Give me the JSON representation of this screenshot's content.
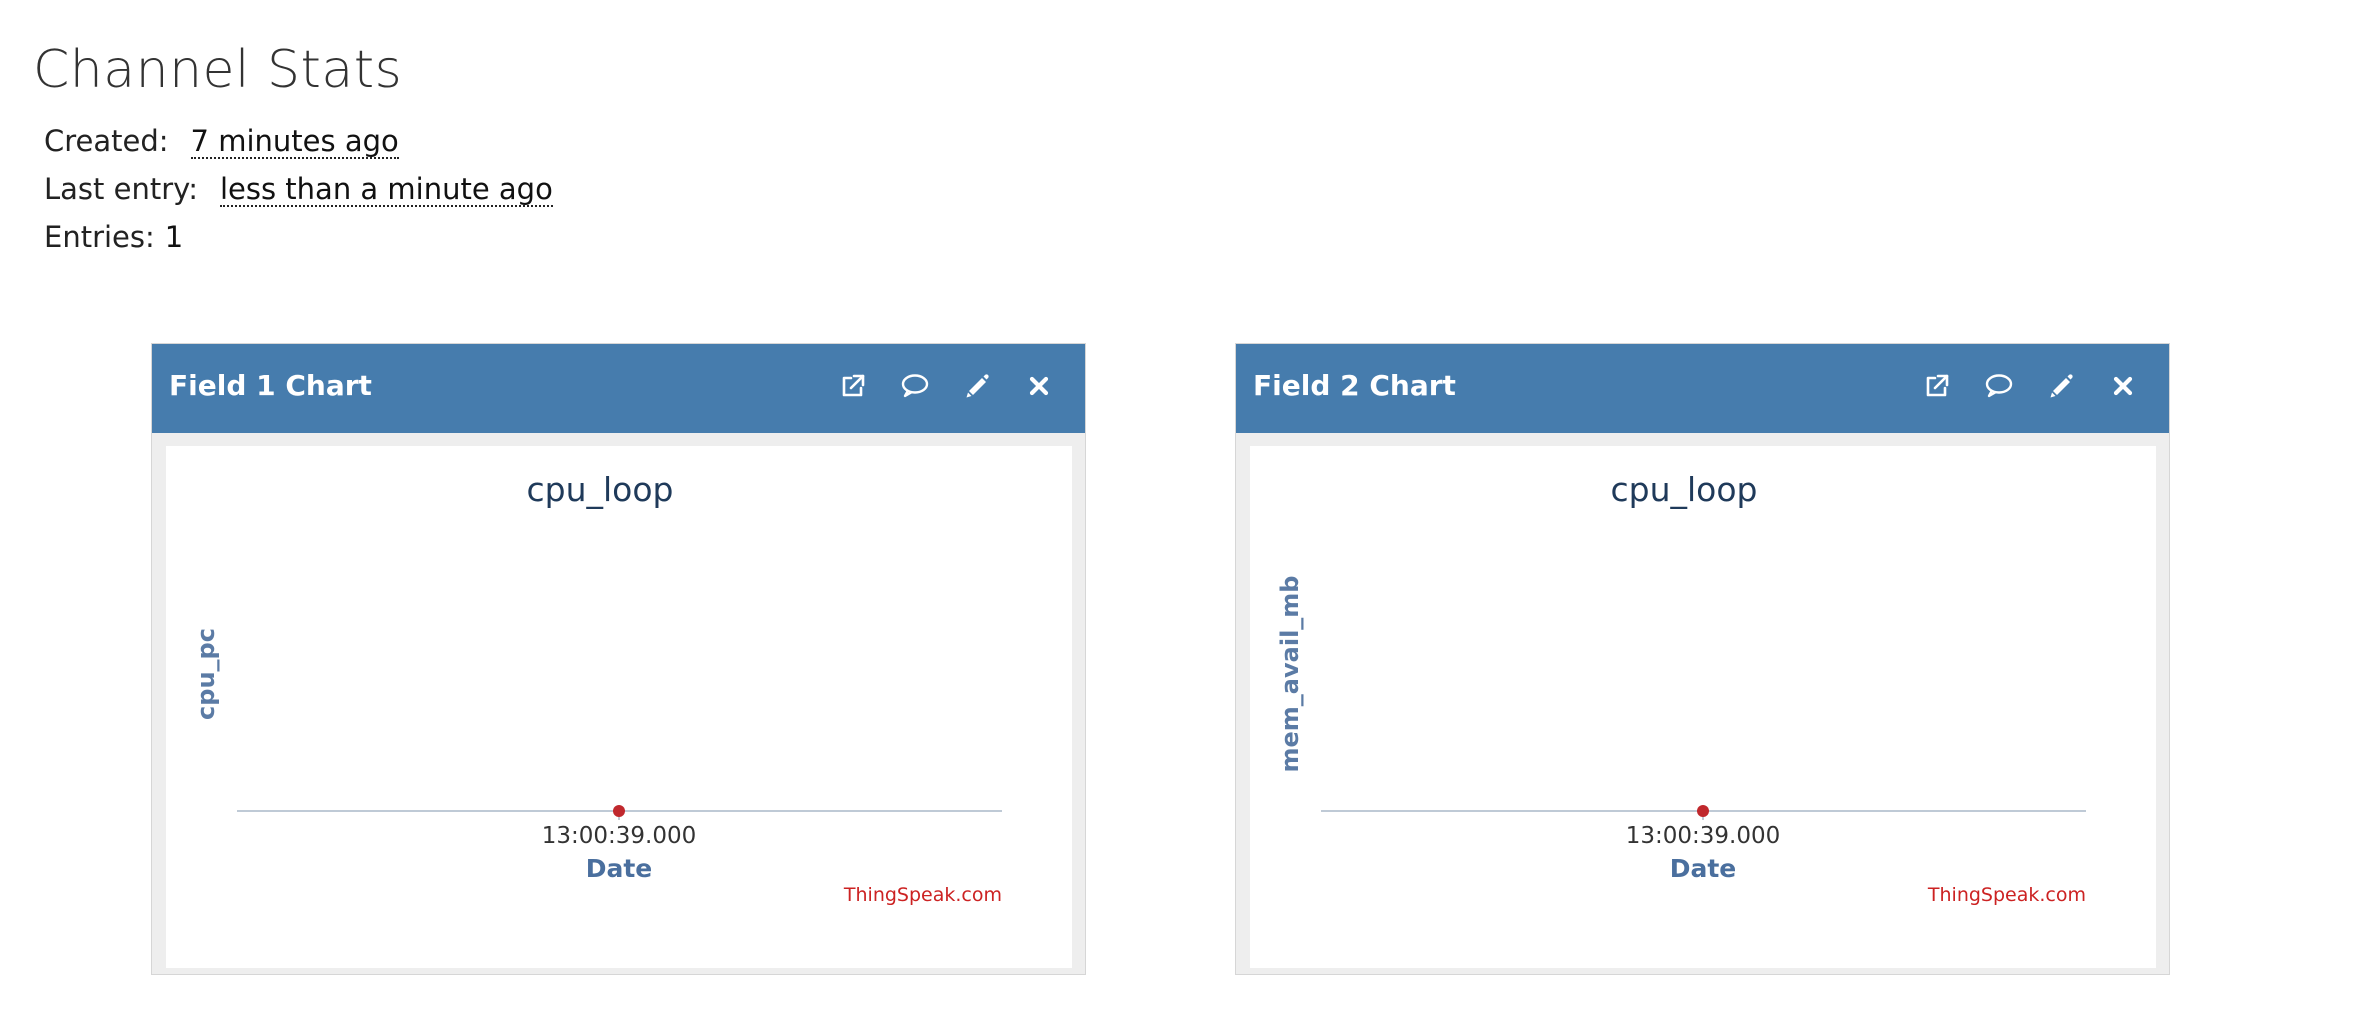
{
  "page": {
    "title": "Channel Stats"
  },
  "stats": {
    "created_label": "Created:",
    "created_value": "7 minutes ago",
    "last_entry_label": "Last entry:",
    "last_entry_value": "less than a minute ago",
    "entries_label": "Entries:",
    "entries_value": "1"
  },
  "widgets": [
    {
      "title": "Field 1 Chart",
      "tools": [
        "external-link-icon",
        "comment-icon",
        "pencil-icon",
        "close-icon"
      ],
      "chart": {
        "title": "cpu_loop",
        "ylabel": "cpu_pc",
        "xlabel": "Date",
        "tick": "13:00:39.000",
        "credits": "ThingSpeak.com"
      }
    },
    {
      "title": "Field 2 Chart",
      "tools": [
        "external-link-icon",
        "comment-icon",
        "pencil-icon",
        "close-icon"
      ],
      "chart": {
        "title": "cpu_loop",
        "ylabel": "mem_avail_mb",
        "xlabel": "Date",
        "tick": "13:00:39.000",
        "credits": "ThingSpeak.com"
      }
    }
  ],
  "colors": {
    "header": "#467cad",
    "point": "#c0282d",
    "axis": "#bfcad6",
    "credits": "#cc2222"
  },
  "chart_data": [
    {
      "type": "line",
      "title": "cpu_loop",
      "xlabel": "Date",
      "ylabel": "cpu_pc",
      "x": [
        "13:00:39.000"
      ],
      "series": [
        {
          "values": [
            null
          ]
        }
      ],
      "grid": false,
      "legend": "none"
    },
    {
      "type": "line",
      "title": "cpu_loop",
      "xlabel": "Date",
      "ylabel": "mem_avail_mb",
      "x": [
        "13:00:39.000"
      ],
      "series": [
        {
          "values": [
            null
          ]
        }
      ],
      "grid": false,
      "legend": "none"
    }
  ]
}
